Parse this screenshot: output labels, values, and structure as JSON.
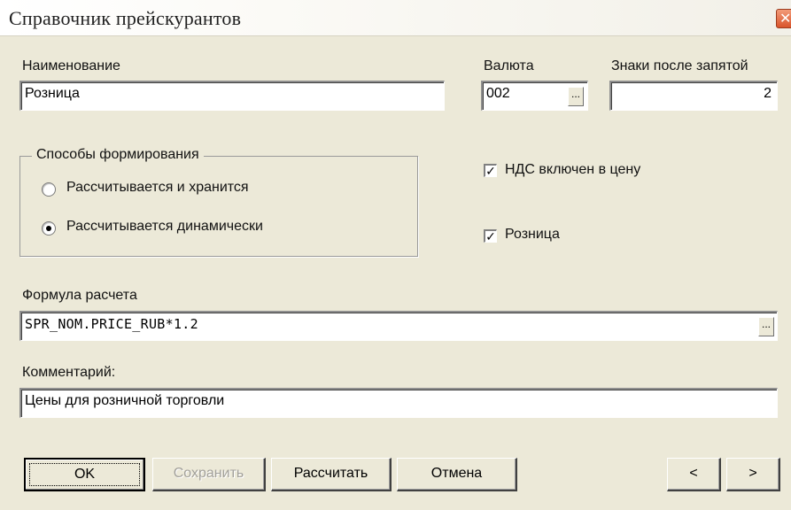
{
  "window": {
    "title": "Справочник прейскурантов",
    "close_glyph": "✕",
    "close_icon": "close-icon",
    "accent_close": "#d9542b",
    "background": "#ece9d8"
  },
  "name": {
    "label": "Наименование",
    "value": "Розница"
  },
  "currency": {
    "label": "Валюта",
    "value": "002",
    "browse_label": "..."
  },
  "decimals": {
    "label": "Знаки после запятой",
    "value": "2"
  },
  "methods": {
    "title": "Способы формирования",
    "options": [
      {
        "label": "Рассчитывается и хранится",
        "selected": false
      },
      {
        "label": "Рассчитывается динамически",
        "selected": true
      }
    ]
  },
  "vat": {
    "label": "НДС включен  в цену",
    "checked": true,
    "mark": "✓"
  },
  "retail": {
    "label": "Розница",
    "checked": true,
    "mark": "✓"
  },
  "formula": {
    "label": "Формула расчета",
    "value": "SPR_NOM.PRICE_RUB*1.2",
    "browse_label": "..."
  },
  "comment": {
    "label": "Комментарий:",
    "value": "Цены для розничной торговли"
  },
  "buttons": {
    "ok": "OK",
    "save": "Сохранить",
    "calculate": "Рассчитать",
    "cancel": "Отмена",
    "prev": "<",
    "next": ">"
  }
}
